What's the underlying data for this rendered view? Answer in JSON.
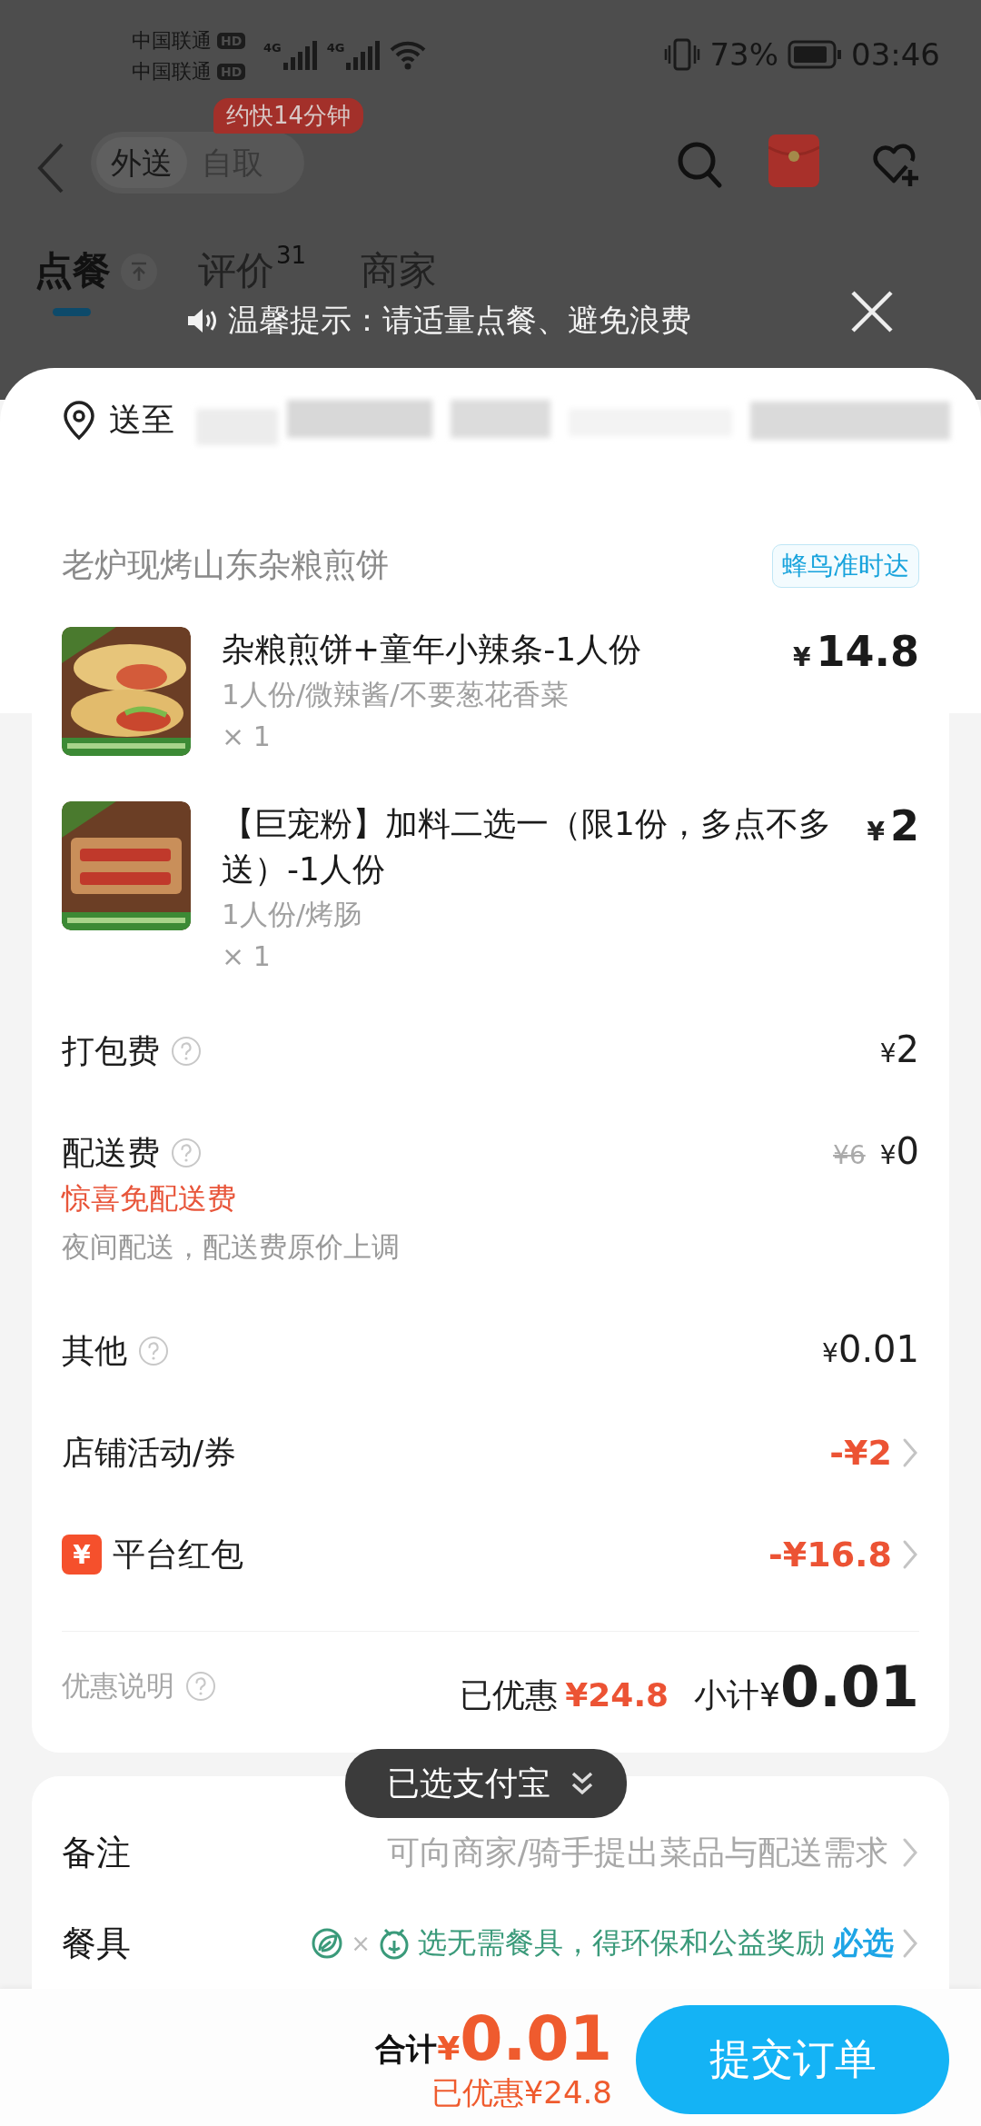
{
  "status_bar": {
    "carriers": [
      {
        "name": "中国联通",
        "badge": "HD",
        "network": "4G"
      },
      {
        "name": "中国联通",
        "badge": "HD",
        "network": "4G"
      }
    ],
    "battery": "73%",
    "time": "03:46"
  },
  "header": {
    "eta_badge": "约快14分钟",
    "modes": [
      {
        "label": "外送",
        "selected": true
      },
      {
        "label": "自取",
        "selected": false
      }
    ]
  },
  "tabs": [
    {
      "label": "点餐",
      "selected": true
    },
    {
      "label": "评价",
      "count": "31",
      "selected": false
    },
    {
      "label": "商家",
      "selected": false
    }
  ],
  "tip": {
    "text": "温馨提示：请适量点餐、避免浪费"
  },
  "address": {
    "label": "送至"
  },
  "store": {
    "name": "老炉现烤山东杂粮煎饼",
    "tag": "蜂鸟准时达"
  },
  "items": [
    {
      "name": "杂粮煎饼+童年小辣条-1人份",
      "specs": "1人份/微辣酱/不要葱花香菜",
      "quantity": "× 1",
      "currency": "¥",
      "price": "14.8"
    },
    {
      "name": "【巨宠粉】加料二选一（限1份，多点不多送）-1人份",
      "specs": "1人份/烤肠",
      "quantity": "× 1",
      "currency": "¥",
      "price": "2"
    }
  ],
  "fees": [
    {
      "kind": "fee",
      "label": "打包费",
      "help": true,
      "currency": "¥",
      "amount": "2"
    },
    {
      "kind": "delivery",
      "label": "配送费",
      "help": true,
      "original": "¥6",
      "currency": "¥",
      "amount": "0",
      "promo": "惊喜免配送费",
      "note": "夜间配送，配送费原价上调"
    },
    {
      "kind": "fee",
      "label": "其他",
      "help": true,
      "currency": "¥",
      "amount": "0.01"
    },
    {
      "kind": "discount",
      "label": "店铺活动/券",
      "amount": "-¥2"
    },
    {
      "kind": "discount",
      "label": "平台红包",
      "badge": "¥",
      "amount": "-¥16.8"
    }
  ],
  "summary": {
    "link": "优惠说明",
    "saved_label": "已优惠",
    "saved": "¥24.8",
    "subtotal_label": "小计",
    "currency": "¥",
    "subtotal": "0.01"
  },
  "remarks": {
    "label": "备注",
    "placeholder": "可向商家/骑手提出菜品与配送需求"
  },
  "tableware": {
    "label": "餐具",
    "separator": "×",
    "hint": "选无需餐具，得环保和公益奖励",
    "action": "必选"
  },
  "toast": {
    "text": "已选支付宝"
  },
  "footer": {
    "total_label": "合计",
    "currency": "¥",
    "total": "0.01",
    "saved": "已优惠¥24.8",
    "submit": "提交订单"
  }
}
